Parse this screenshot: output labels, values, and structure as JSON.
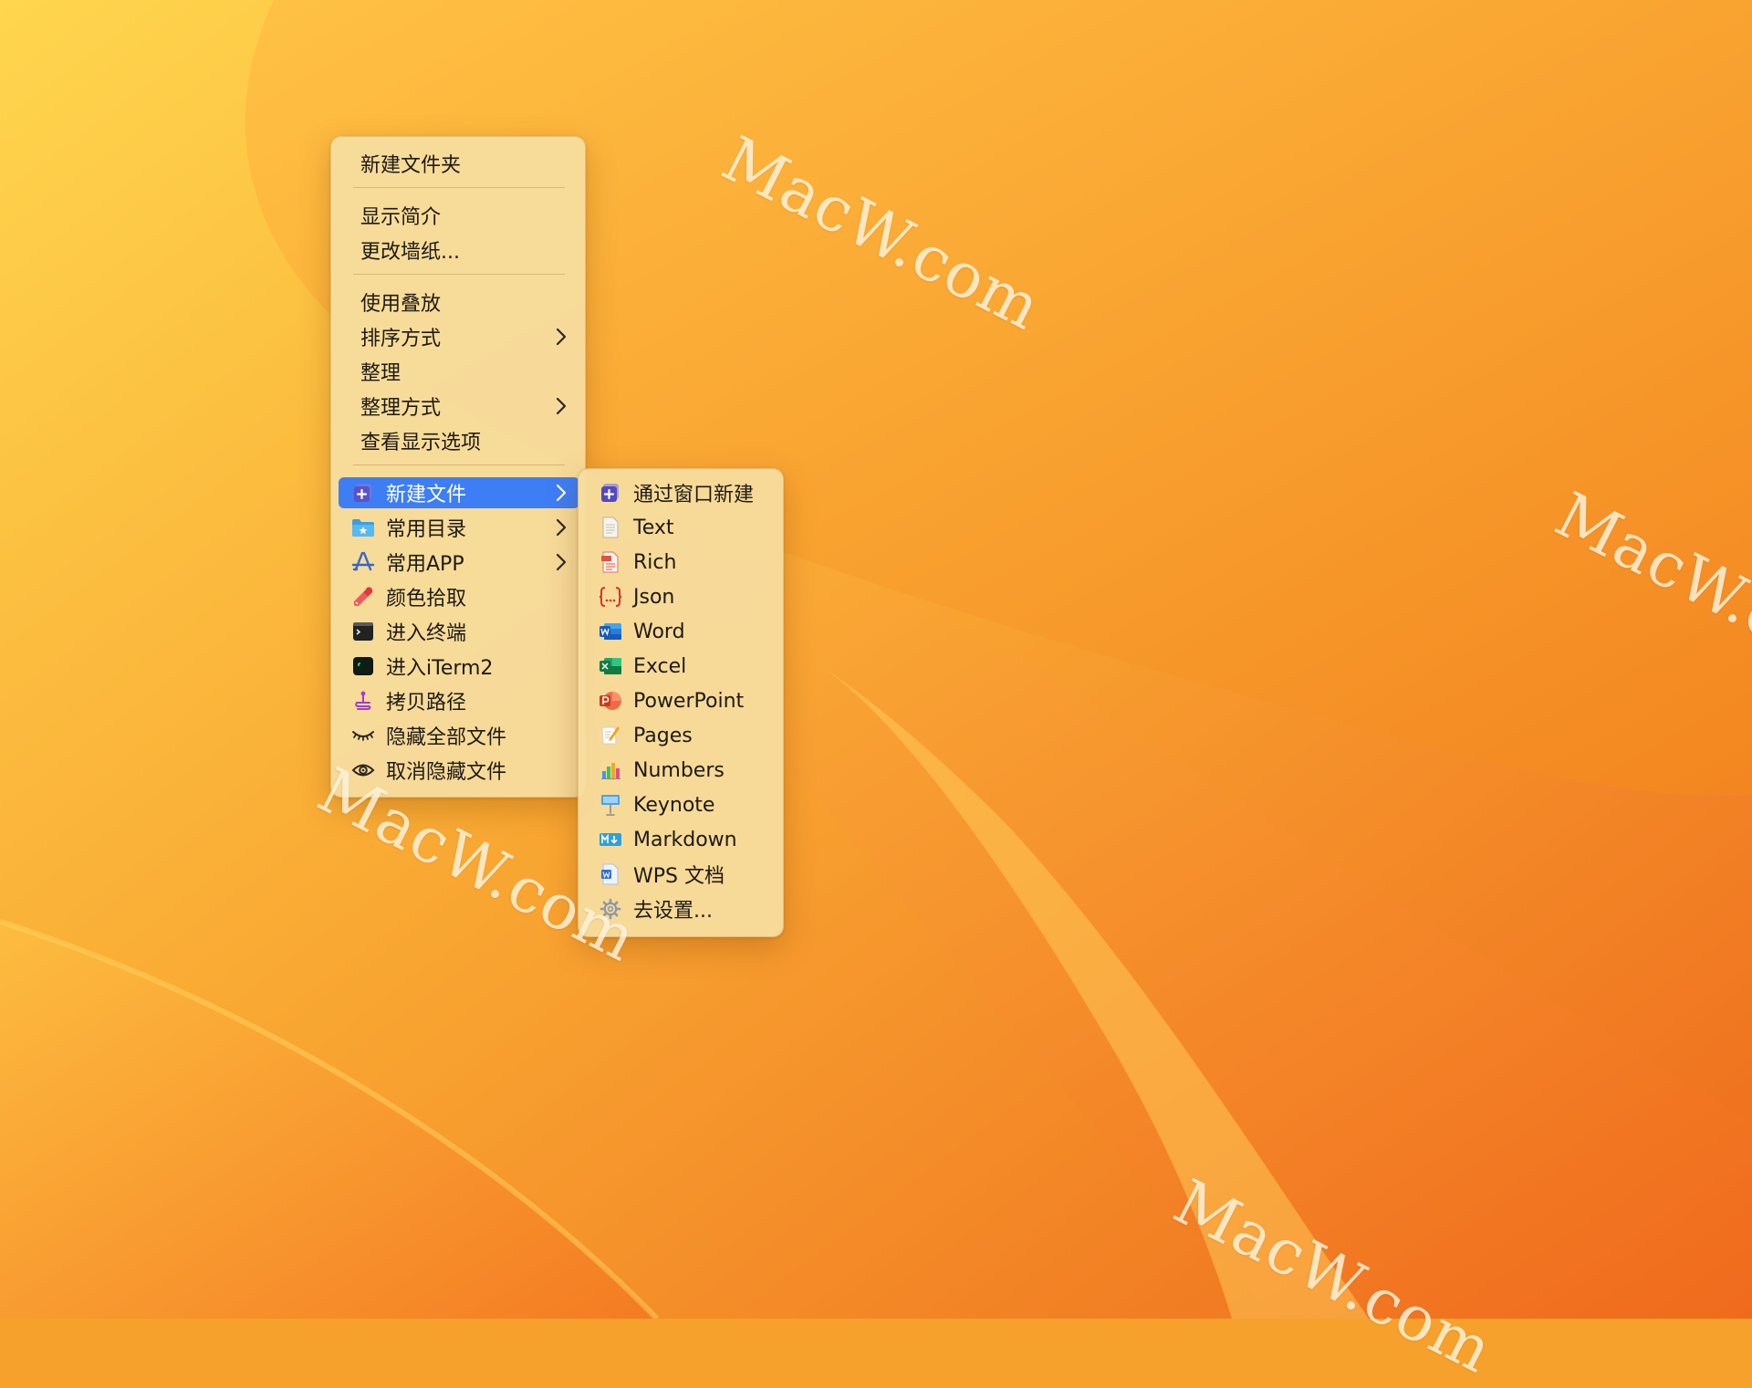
{
  "desktop": {
    "watermark_text": "MacW.com",
    "colors": {
      "wallpaper_light": "#ffd24a",
      "wallpaper_mid": "#f8a530",
      "wallpaper_deep": "#ef6a1b",
      "menu_bg": "#f6dea0",
      "highlight": "#3d7ef5"
    }
  },
  "context_menu": {
    "items": [
      {
        "label": "新建文件夹"
      },
      {
        "label": "显示简介"
      },
      {
        "label": "更改墙纸..."
      },
      {
        "label": "使用叠放"
      },
      {
        "label": "排序方式",
        "submenu": true
      },
      {
        "label": "整理"
      },
      {
        "label": "整理方式",
        "submenu": true
      },
      {
        "label": "查看显示选项"
      },
      {
        "label": "新建文件",
        "icon": "new-file-icon",
        "submenu": true,
        "highlighted": true
      },
      {
        "label": "常用目录",
        "icon": "folder-icon",
        "submenu": true
      },
      {
        "label": "常用APP",
        "icon": "app-store-icon",
        "submenu": true
      },
      {
        "label": "颜色拾取",
        "icon": "eyedropper-icon"
      },
      {
        "label": "进入终端",
        "icon": "terminal-icon"
      },
      {
        "label": "进入iTerm2",
        "icon": "iterm-icon"
      },
      {
        "label": "拷贝路径",
        "icon": "copy-path-icon"
      },
      {
        "label": "隐藏全部文件",
        "icon": "closed-eye-icon"
      },
      {
        "label": "取消隐藏文件",
        "icon": "eye-icon"
      }
    ]
  },
  "new_file_submenu": {
    "items": [
      {
        "label": "通过窗口新建",
        "icon": "window-new-icon"
      },
      {
        "label": "Text",
        "icon": "text-file-icon"
      },
      {
        "label": "Rich",
        "icon": "rtf-file-icon"
      },
      {
        "label": "Json",
        "icon": "json-file-icon"
      },
      {
        "label": "Word",
        "icon": "word-icon"
      },
      {
        "label": "Excel",
        "icon": "excel-icon"
      },
      {
        "label": "PowerPoint",
        "icon": "powerpoint-icon"
      },
      {
        "label": "Pages",
        "icon": "pages-icon"
      },
      {
        "label": "Numbers",
        "icon": "numbers-icon"
      },
      {
        "label": "Keynote",
        "icon": "keynote-icon"
      },
      {
        "label": "Markdown",
        "icon": "markdown-icon"
      },
      {
        "label": "WPS 文档",
        "icon": "wps-icon"
      },
      {
        "label": "去设置...",
        "icon": "gear-icon"
      }
    ]
  }
}
